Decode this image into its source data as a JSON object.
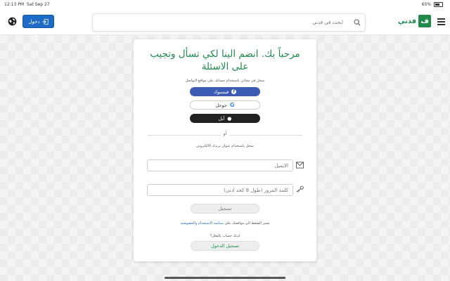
{
  "status": {
    "time": "12:13 PM",
    "date": "Sat Sep 27",
    "battery": "65%"
  },
  "header": {
    "login_label": "دخول",
    "search_placeholder": "ابحث في فدني",
    "logo_text": "فدني",
    "logo_mark": "ف",
    "brand_color": "#1f8a4c",
    "accent_color": "#1e6bc5"
  },
  "card": {
    "title": "مرحباً بك. انضم الينا لكي تسأل وتجيب على الاسئلة",
    "social_hint": "سجل في مجاني باستخدام حسابك على مواقع التواصل",
    "facebook_label": "فيسبوك",
    "google_label": "جوجل",
    "apple_label": "آبل",
    "or_label": "أو",
    "email_hint": "سجل باستخدام عنوان بريدك الالكتروني",
    "email_placeholder": "الايميل",
    "password_placeholder": "كلمة المرور (طول 8 كحد ادنى)",
    "register_label": "تسجيل",
    "terms_prefix": "تشير الضغط الى موافقتك على",
    "terms_link": "سياسة الاستخدام والخصوصية",
    "have_account": "لديك حساب بالفعل؟",
    "signin_label": "تسجيل الدخول"
  },
  "icons": {
    "globe": "globe-icon",
    "login": "login-icon",
    "search": "search-icon",
    "menu": "hamburger-menu-icon",
    "email": "envelope-icon",
    "password": "key-icon"
  }
}
